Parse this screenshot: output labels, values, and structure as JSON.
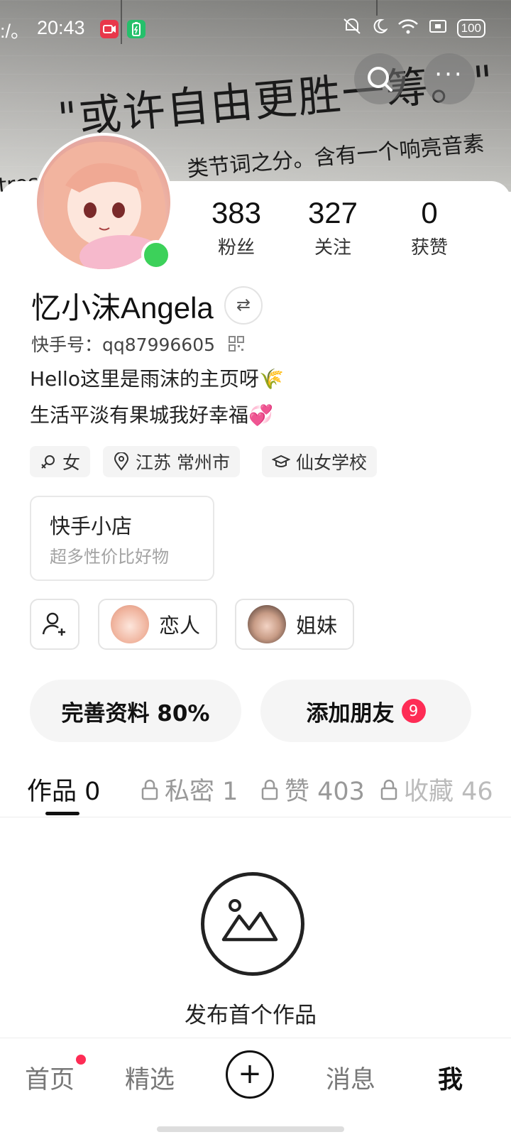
{
  "status_bar": {
    "time": "20:43",
    "battery": "100",
    "leading": ":/。"
  },
  "cover": {
    "handwriting": "\"或许自由更胜一筹。\"",
    "print_line_left": "tres",
    "print_line_mid": "类节词之分。含有一个响亮音素"
  },
  "header_buttons": {
    "search_icon": "search-icon",
    "more_icon": "more-icon"
  },
  "profile": {
    "name": "忆小沫Angela",
    "kuaishou_id_label": "快手号：",
    "kuaishou_id": "qq87996605",
    "bio_line1": "Hello这里是雨沫的主页呀🌾",
    "bio_line2": "生活平淡有果城我好幸福💞",
    "online_color": "#3cd15a"
  },
  "stats": [
    {
      "num": "383",
      "label": "粉丝"
    },
    {
      "num": "327",
      "label": "关注"
    },
    {
      "num": "0",
      "label": "获赞"
    }
  ],
  "tags": {
    "gender": "女",
    "location": "江苏 常州市",
    "school": "仙女学校"
  },
  "shop": {
    "title": "快手小店",
    "subtitle": "超多性价比好物"
  },
  "relations": {
    "lover": "恋人",
    "sister": "姐妹"
  },
  "actions": {
    "complete_profile": "完善资料 80%",
    "add_friends": "添加朋友",
    "add_friends_badge": "9",
    "badge_color": "#fe2c55"
  },
  "tabs": {
    "works": "作品 0",
    "private": "私密 1",
    "likes": "赞 403",
    "favorites": "收藏 46"
  },
  "empty_state": {
    "text": "发布首个作品"
  },
  "bottom_nav": {
    "home": "首页",
    "featured": "精选",
    "messages": "消息",
    "me": "我"
  }
}
